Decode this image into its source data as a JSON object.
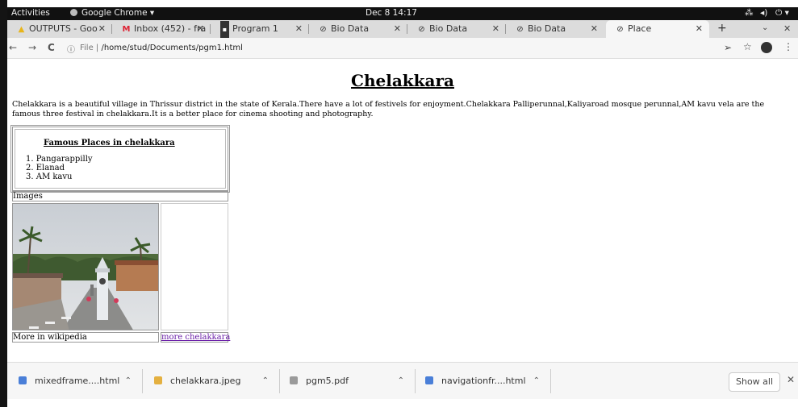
{
  "system_bar": {
    "activities": "Activities",
    "app_name": "Google Chrome ▾",
    "clock": "Dec 8  14:17"
  },
  "tabs": [
    {
      "label": "OUTPUTS - Goo",
      "icon": "drive-icon"
    },
    {
      "label": "Inbox (452) - fra",
      "icon": "gmail-icon"
    },
    {
      "label": "Program 1",
      "icon": "page-icon"
    },
    {
      "label": "Bio Data",
      "icon": "globe-icon"
    },
    {
      "label": "Bio Data",
      "icon": "globe-icon"
    },
    {
      "label": "Bio Data",
      "icon": "globe-icon"
    },
    {
      "label": "Place",
      "icon": "globe-icon",
      "active": true
    }
  ],
  "address_bar": {
    "prefix": "File  |  ",
    "path": "/home/stud/Documents/pgm1.html"
  },
  "page": {
    "title": "Chelakkara",
    "paragraph": "Chelakkara is a beautiful village in Thrissur district in the state of Kerala.There have a lot of festivels for enjoyment.Chelakkara Palliperunnal,Kaliyaroad mosque perunnal,AM kavu vela are the famous three festival in chelakkara.It is a better place for cinema shooting and photography.",
    "famous_heading": "Famous Places in chelakkara",
    "famous_places": [
      "Pangarappilly",
      "Elanad",
      "AM kavu"
    ],
    "images_label": "Images",
    "more_label": "More in wikipedia",
    "more_link": "more chelakkara"
  },
  "downloads": [
    {
      "name": "mixedframe....html",
      "color": "#4a7fd8"
    },
    {
      "name": "chelakkara.jpeg",
      "color": "#e4b040"
    },
    {
      "name": "pgm5.pdf",
      "color": "#9a9a9a"
    },
    {
      "name": "navigationfr....html",
      "color": "#4a7fd8"
    }
  ],
  "show_all": "Show all"
}
